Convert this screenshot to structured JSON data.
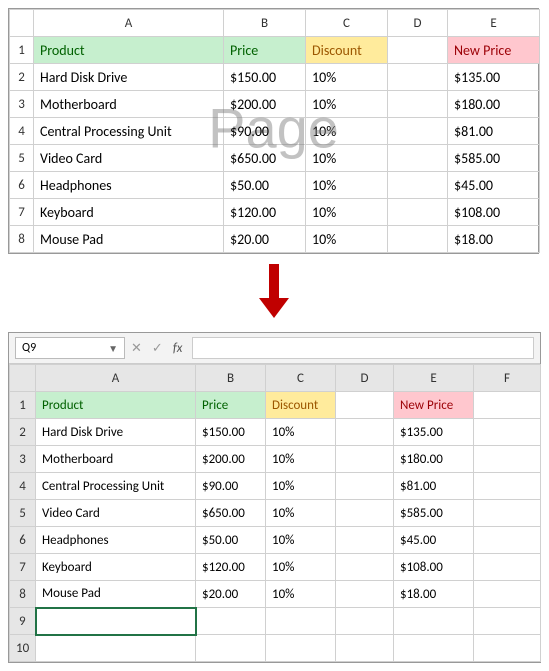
{
  "watermark": "Page",
  "columns": [
    "A",
    "B",
    "C",
    "D",
    "E"
  ],
  "columns2": [
    "A",
    "B",
    "C",
    "D",
    "E",
    "F"
  ],
  "row_numbers": [
    "1",
    "2",
    "3",
    "4",
    "5",
    "6",
    "7",
    "8"
  ],
  "row_numbers2": [
    "1",
    "2",
    "3",
    "4",
    "5",
    "6",
    "7",
    "8",
    "9",
    "10"
  ],
  "headers": {
    "product": "Product",
    "price": "Price",
    "discount": "Discount",
    "new_price": "New Price"
  },
  "currency_symbol": "$",
  "rows": [
    {
      "product": "Hard Disk Drive",
      "price": "150.00",
      "discount": "10%",
      "new_price": "135.00"
    },
    {
      "product": "Motherboard",
      "price": "200.00",
      "discount": "10%",
      "new_price": "180.00"
    },
    {
      "product": "Central Processing Unit",
      "price": "90.00",
      "discount": "10%",
      "new_price": "81.00"
    },
    {
      "product": "Video Card",
      "price": "650.00",
      "discount": "10%",
      "new_price": "585.00"
    },
    {
      "product": "Headphones",
      "price": "50.00",
      "discount": "10%",
      "new_price": "45.00"
    },
    {
      "product": "Keyboard",
      "price": "120.00",
      "discount": "10%",
      "new_price": "108.00"
    },
    {
      "product": "Mouse Pad",
      "price": "20.00",
      "discount": "10%",
      "new_price": "18.00"
    }
  ],
  "namebox": "Q9",
  "formula_bar": {
    "cancel": "✕",
    "confirm": "✓",
    "fx": "fx"
  }
}
